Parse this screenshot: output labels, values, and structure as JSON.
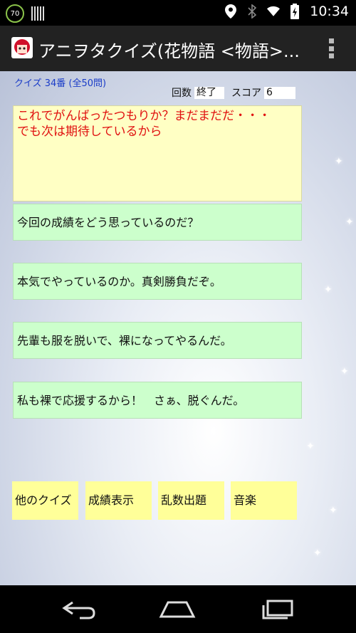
{
  "status": {
    "battery_badge": "70",
    "time": "10:34"
  },
  "app": {
    "title": "アニヲタクイズ(花物語 <物語>..."
  },
  "quiz": {
    "number_label": "クイズ 34番 (全50問)",
    "round_label": "回数",
    "round_value": "終了",
    "score_label": "スコア",
    "score_value": "6"
  },
  "question_lines": [
    "これでがんばったつもりか？まだまだだ・・・",
    "でも次は期待しているから"
  ],
  "answers": [
    "今回の成績をどう思っているのだ？",
    "本気でやっているのか。真剣勝負だぞ。",
    "先輩も服を脱いで、裸になってやるんだ。",
    "私も裸で応援するから！　さぁ、脱ぐんだ。"
  ],
  "buttons": [
    "他のクイズ",
    "成績表示",
    "乱数出題",
    "音楽"
  ],
  "colors": {
    "question_bg": "#ffffc4",
    "question_text": "#e01010",
    "answer_bg": "#ccffcc",
    "button_bg": "#ffff99",
    "quiz_num_text": "#1a3cc8"
  }
}
